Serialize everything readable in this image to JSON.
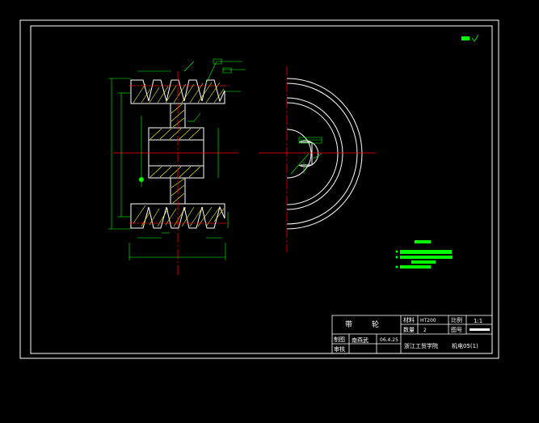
{
  "colors": {
    "background": "#000000",
    "frame": "#ffffff",
    "outline": "#ffffff",
    "dimension": "#00ff00",
    "centerline": "#ff0000",
    "hatch": "#ffff00"
  },
  "title_block": {
    "part_name_1": "带",
    "part_name_2": "轮",
    "material_label": "材料",
    "material_value": "HT200",
    "quantity_label": "数量",
    "quantity_value": "2",
    "scale_label": "比例",
    "scale_value": "1:1",
    "drawing_no_label": "图号",
    "drawn_label": "制图",
    "drawn_name": "南燕武",
    "drawn_date": "06.4.25",
    "checked_label": "审核",
    "school": "浙江工贸学院",
    "class_name": "机电05(1)"
  },
  "icons": {
    "roughness": "roughness-symbol-icon"
  }
}
